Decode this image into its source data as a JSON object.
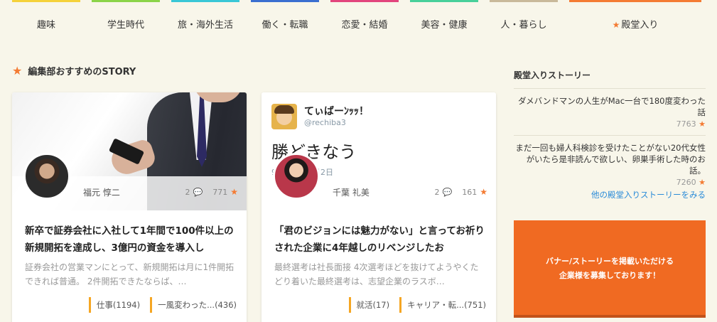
{
  "nav": {
    "categories": [
      {
        "label": "趣味",
        "color": "#f5d23a"
      },
      {
        "label": "学生時代",
        "color": "#8bd449"
      },
      {
        "label": "旅・海外生活",
        "color": "#39c7d6"
      },
      {
        "label": "働く・転職",
        "color": "#3b6fd0"
      },
      {
        "label": "恋愛・結婚",
        "color": "#e2457d"
      },
      {
        "label": "美容・健康",
        "color": "#48d09a"
      },
      {
        "label": "人・暮らし",
        "color": "#c9b99a"
      },
      {
        "label": "殿堂入り",
        "color": "#f47b33"
      }
    ]
  },
  "section": {
    "title": "編集部おすすめのSTORY"
  },
  "cards": [
    {
      "author": "福元 惇二",
      "comments": "2",
      "likes": "771",
      "title": "新卒で証券会社に入社して1年間で100件以上の新規開拓を達成し、3億円の資金を導入し",
      "desc": "証券会社の営業マンにとって、新規開拓は月に1件開拓できれば普通。 2件開拓できたならば、…",
      "tags": [
        "仕事(1194)",
        "一風変わった...(436)"
      ]
    },
    {
      "author": "千葉 礼美",
      "comments": "2",
      "likes": "161",
      "tweet": {
        "name": "てぃばーﾝｯｯ！",
        "handle": "@rechiba3",
        "text": "勝どきなう",
        "date": "9　　　　8月2日"
      },
      "title": "「君のビジョンには魅力がない」と言ってお祈りされた企業に4年越しのリベンジしたお",
      "desc": "最終選考は社長面接 4次選考ほどを抜けてようやくたどり着いた最終選考は、志望企業のラスボ…",
      "tags": [
        "就活(17)",
        "キャリア・転...(751)"
      ]
    }
  ],
  "sidebar": {
    "title": "殿堂入りストーリー",
    "items": [
      {
        "text": "ダメバンドマンの人生がMac一台で180度変わった話",
        "count": "7763"
      },
      {
        "text": "まだ一回も婦人科検診を受けたことがない20代女性がいたら是非読んで欲しい、卵巣手術した時のお話。",
        "count": "7260"
      }
    ],
    "more": "他の殿堂入りストーリーをみる",
    "banner": {
      "line1": "バナー/ストーリーを掲載いただける",
      "line2": "企業様を募集しております！"
    }
  }
}
